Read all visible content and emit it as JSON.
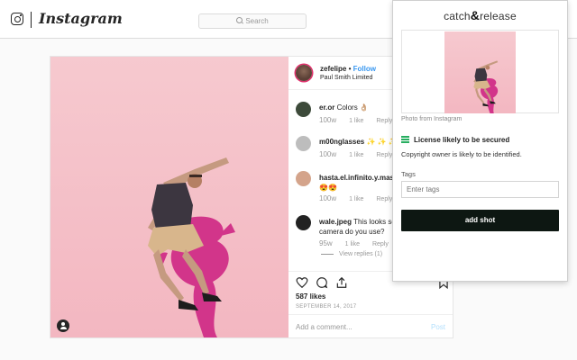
{
  "nav": {
    "wordmark": "Instagram",
    "search_placeholder": "Search"
  },
  "post": {
    "username": "zefelipe",
    "follow": "Follow",
    "location": "Paul Smith Limited",
    "comments": [
      {
        "user": "er.or",
        "text": "Colors 👌🏼",
        "time": "100w",
        "likes": "1 like",
        "reply": "Reply"
      },
      {
        "user": "m00nglasses",
        "text": "✨ ✨ ✨",
        "time": "100w",
        "likes": "1 like",
        "reply": "Reply"
      },
      {
        "user": "hasta.el.infinito.y.mas...",
        "text": "😍😍",
        "time": "100w",
        "likes": "1 like",
        "reply": "Reply"
      },
      {
        "user": "wale.jpeg",
        "text": "This looks so",
        "text2": "camera do you use?",
        "time": "95w",
        "likes": "1 like",
        "reply": "Reply",
        "view_replies": "View replies (1)"
      }
    ],
    "likes_count": "587 likes",
    "date": "SEPTEMBER 14, 2017",
    "add_comment_placeholder": "Add a comment...",
    "post_button": "Post"
  },
  "extension": {
    "brand_left": "catch",
    "brand_amp": "&",
    "brand_right": "release",
    "photo_source": "Photo from Instagram",
    "license_status": "License likely to be secured",
    "copyright_note": "Copyright owner is likely to be identified.",
    "tags_label": "Tags",
    "tags_placeholder": "Enter tags",
    "add_button": "add shot",
    "accent_color": "#27ae60"
  }
}
